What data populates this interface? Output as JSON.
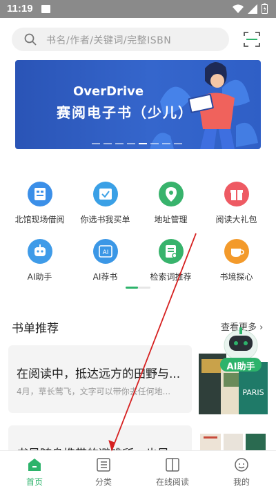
{
  "status_bar": {
    "time": "11:19"
  },
  "search": {
    "placeholder": "书名/作者/关键词/完整ISBN"
  },
  "banner": {
    "brand": "OverDrive",
    "subtitle": "赛阅电子书（少儿）"
  },
  "menu": [
    {
      "label": "北馆现场借阅",
      "icon": "library-card-icon",
      "color": "#3b8fe8"
    },
    {
      "label": "你选书我买单",
      "icon": "shopping-cart-icon",
      "color": "#3aa0e6"
    },
    {
      "label": "地址管理",
      "icon": "location-pin-icon",
      "color": "#38b36c"
    },
    {
      "label": "阅读大礼包",
      "icon": "gift-box-icon",
      "color": "#ee5a63"
    },
    {
      "label": "AI助手",
      "icon": "robot-icon",
      "color": "#3f9be8"
    },
    {
      "label": "AI荐书",
      "icon": "ai-book-icon",
      "color": "#3b97e6"
    },
    {
      "label": "检索词推荐",
      "icon": "search-list-icon",
      "color": "#38b36c"
    },
    {
      "label": "书境探心",
      "icon": "tea-cup-icon",
      "color": "#f39a2b"
    }
  ],
  "booklist": {
    "title": "书单推荐",
    "more": "查看更多",
    "ai_badge": "AI助手",
    "cards": [
      {
        "title": "在阅读中，抵达远方的田野与...",
        "subtitle": "4月，草长莺飞，文字可以带你去任何地..."
      },
      {
        "title": "书是随身携带的避难所，也是...",
        "subtitle": ""
      }
    ]
  },
  "tabs": [
    {
      "label": "首页",
      "icon": "home-icon",
      "active": true
    },
    {
      "label": "分类",
      "icon": "category-list-icon",
      "active": false
    },
    {
      "label": "在线阅读",
      "icon": "open-book-icon",
      "active": false
    },
    {
      "label": "我的",
      "icon": "profile-icon",
      "active": false
    }
  ],
  "colors": {
    "accent": "#2db36b",
    "banner": "#3063c9",
    "annotation_arrow": "#d62020"
  }
}
